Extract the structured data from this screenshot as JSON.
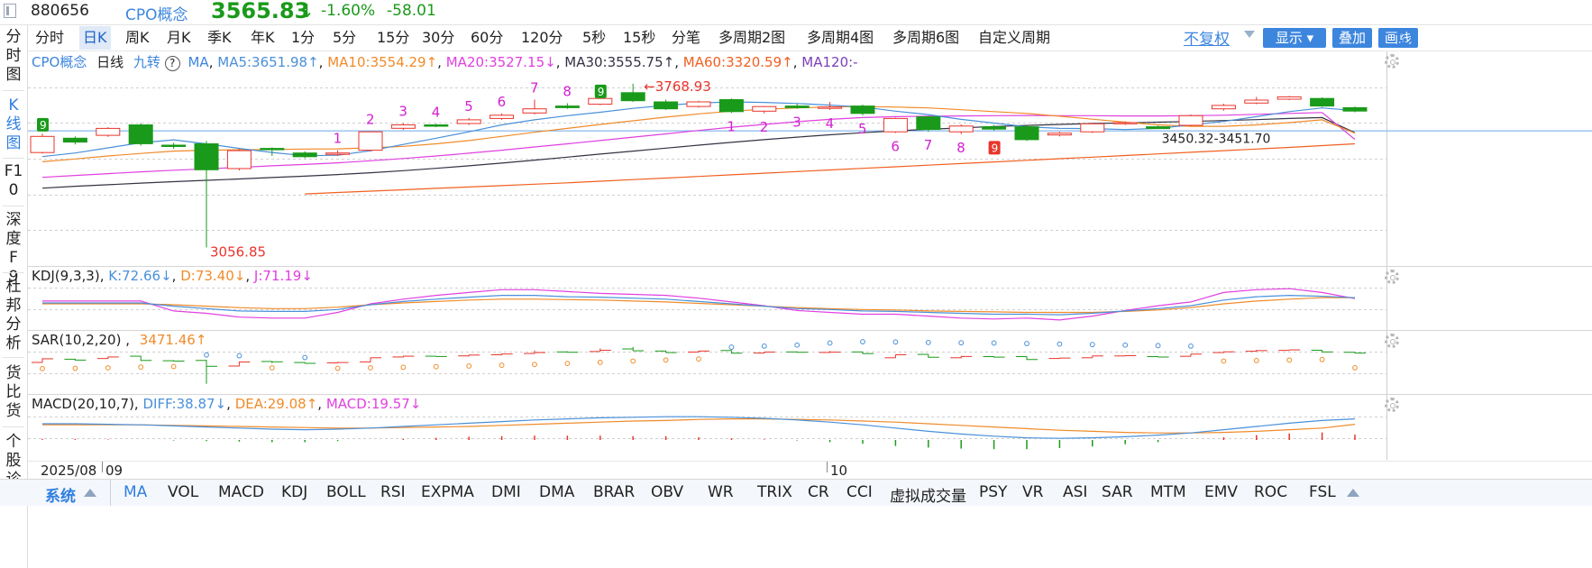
{
  "header": {
    "code": "880656",
    "name": "CPO概念",
    "price": "3565.83",
    "change_pct": "-1.60%",
    "change_val": "-58.01"
  },
  "left_tabs": [
    "分时图",
    "K线图",
    "F10",
    "深度F9",
    "杜邦分析",
    "货比货",
    "个股诊断"
  ],
  "periods": [
    "分时",
    "日K",
    "周K",
    "月K",
    "季K",
    "年K",
    "1分",
    "5分",
    "15分",
    "30分",
    "60分",
    "120分",
    "5秒",
    "15秒",
    "分笔",
    "多周期2图",
    "多周期4图",
    "多周期6图",
    "自定义周期"
  ],
  "period_active": "日K",
  "right_tools": {
    "fq": "不复权",
    "display": "显示",
    "overlay": "叠加",
    "draw": "画线"
  },
  "main_legend": {
    "name": "CPO概念",
    "period": "日线",
    "nine": "九转",
    "help": "?",
    "ma": "MA",
    "ma5": "MA5:3651.98↑",
    "ma10": "MA10:3554.29↑",
    "ma20": "MA20:3527.15↓",
    "ma30": "MA30:3555.75↑",
    "ma60": "MA60:3320.59↑",
    "ma120": "MA120:-"
  },
  "main_annotations": {
    "high": "3768.93",
    "low": "3056.85",
    "range": "3450.32-3451.70",
    "top_counts": [
      "1",
      "2",
      "3",
      "4",
      "5",
      "6",
      "7",
      "8"
    ],
    "bottom_counts": [
      "1",
      "2",
      "3",
      "4",
      "5",
      "6",
      "7",
      "8"
    ],
    "nine_badge": "9"
  },
  "kdj_legend": {
    "name": "KDJ(9,3,3)",
    "k": "K:72.66↓",
    "d": "D:73.40↓",
    "j": "J:71.19↓"
  },
  "sar_legend": {
    "name": "SAR(10,2,20)",
    "sep": ",",
    "val": "3471.46↑"
  },
  "macd_legend": {
    "name": "MACD(20,10,7)",
    "diff": "DIFF:38.87↓",
    "dea": "DEA:29.08↑",
    "macd": "MACD:19.57↓"
  },
  "dates": {
    "start": "2025/08",
    "d1": "09",
    "d2": "10"
  },
  "indicator_tabs": [
    "系统",
    "MA",
    "VOL",
    "MACD",
    "KDJ",
    "BOLL",
    "RSI",
    "EXPMA",
    "DMI",
    "DMA",
    "BRAR",
    "OBV",
    "WR",
    "TRIX",
    "CR",
    "CCI",
    "虚拟成交量",
    "PSY",
    "VR",
    "ASI",
    "SAR",
    "MTM",
    "EMV",
    "ROC",
    "FSL"
  ],
  "indicator_active": "MA",
  "colors": {
    "up": "#e8352c",
    "down": "#1a9a1a",
    "accent": "#3d86de",
    "ma5": "#4a90d9",
    "ma10": "#f08b2a",
    "ma20": "#e040e0",
    "ma30": "#333344",
    "ma60": "#f06020"
  },
  "candles": [
    {
      "o": 3470,
      "c": 3540,
      "h": 3552,
      "l": 3465
    },
    {
      "o": 3532,
      "c": 3515,
      "h": 3540,
      "l": 3505
    },
    {
      "o": 3545,
      "c": 3575,
      "h": 3580,
      "l": 3538
    },
    {
      "o": 3590,
      "c": 3508,
      "h": 3598,
      "l": 3500
    },
    {
      "o": 3502,
      "c": 3496,
      "h": 3512,
      "l": 3486
    },
    {
      "o": 3508,
      "c": 3395,
      "h": 3520,
      "l": 3057
    },
    {
      "o": 3400,
      "c": 3478,
      "h": 3485,
      "l": 3392
    },
    {
      "o": 3488,
      "c": 3482,
      "h": 3492,
      "l": 3455
    },
    {
      "o": 3468,
      "c": 3452,
      "h": 3475,
      "l": 3445
    },
    {
      "o": 3462,
      "c": 3468,
      "h": 3480,
      "l": 3455
    },
    {
      "o": 3480,
      "c": 3560,
      "h": 3562,
      "l": 3475
    },
    {
      "o": 3575,
      "c": 3590,
      "h": 3598,
      "l": 3568
    },
    {
      "o": 3590,
      "c": 3584,
      "h": 3595,
      "l": 3580
    },
    {
      "o": 3596,
      "c": 3612,
      "h": 3620,
      "l": 3590
    },
    {
      "o": 3618,
      "c": 3632,
      "h": 3640,
      "l": 3612
    },
    {
      "o": 3642,
      "c": 3660,
      "h": 3700,
      "l": 3636
    },
    {
      "o": 3672,
      "c": 3665,
      "h": 3684,
      "l": 3660
    },
    {
      "o": 3680,
      "c": 3705,
      "h": 3740,
      "l": 3676
    },
    {
      "o": 3730,
      "c": 3695,
      "h": 3769,
      "l": 3690
    },
    {
      "o": 3690,
      "c": 3660,
      "h": 3700,
      "l": 3655
    },
    {
      "o": 3670,
      "c": 3690,
      "h": 3695,
      "l": 3665
    },
    {
      "o": 3700,
      "c": 3648,
      "h": 3705,
      "l": 3642
    },
    {
      "o": 3650,
      "c": 3670,
      "h": 3672,
      "l": 3640
    },
    {
      "o": 3672,
      "c": 3665,
      "h": 3682,
      "l": 3660
    },
    {
      "o": 3662,
      "c": 3668,
      "h": 3690,
      "l": 3655
    },
    {
      "o": 3672,
      "c": 3640,
      "h": 3678,
      "l": 3632
    },
    {
      "o": 3560,
      "c": 3618,
      "h": 3622,
      "l": 3555
    },
    {
      "o": 3625,
      "c": 3570,
      "h": 3630,
      "l": 3560
    },
    {
      "o": 3560,
      "c": 3585,
      "h": 3592,
      "l": 3550
    },
    {
      "o": 3582,
      "c": 3572,
      "h": 3590,
      "l": 3565
    },
    {
      "o": 3582,
      "c": 3526,
      "h": 3588,
      "l": 3520
    },
    {
      "o": 3546,
      "c": 3554,
      "h": 3560,
      "l": 3540
    },
    {
      "o": 3560,
      "c": 3595,
      "h": 3600,
      "l": 3555
    },
    {
      "o": 3595,
      "c": 3600,
      "h": 3605,
      "l": 3590
    },
    {
      "o": 3582,
      "c": 3574,
      "h": 3587,
      "l": 3572
    },
    {
      "o": 3588,
      "c": 3630,
      "h": 3636,
      "l": 3584
    },
    {
      "o": 3660,
      "c": 3675,
      "h": 3682,
      "l": 3652
    },
    {
      "o": 3685,
      "c": 3698,
      "h": 3712,
      "l": 3680
    },
    {
      "o": 3702,
      "c": 3712,
      "h": 3716,
      "l": 3698
    },
    {
      "o": 3705,
      "c": 3672,
      "h": 3710,
      "l": 3668
    },
    {
      "o": 3665,
      "c": 3650,
      "h": 3670,
      "l": 3645
    }
  ],
  "ma": {
    "ma5": [
      3452,
      3468,
      3490,
      3512,
      3525,
      3508,
      3488,
      3470,
      3456,
      3458,
      3478,
      3505,
      3532,
      3560,
      3590,
      3612,
      3630,
      3645,
      3662,
      3675,
      3685,
      3690,
      3688,
      3683,
      3676,
      3668,
      3650,
      3635,
      3614,
      3598,
      3582,
      3575,
      3574,
      3570,
      3575,
      3590,
      3605,
      3626,
      3648,
      3664,
      3652
    ],
    "ma10": [
      3430,
      3442,
      3455,
      3466,
      3476,
      3480,
      3482,
      3483,
      3485,
      3486,
      3490,
      3497,
      3508,
      3522,
      3540,
      3558,
      3575,
      3592,
      3608,
      3624,
      3638,
      3650,
      3658,
      3664,
      3668,
      3670,
      3668,
      3664,
      3656,
      3648,
      3640,
      3628,
      3615,
      3602,
      3590,
      3584,
      3584,
      3590,
      3600,
      3612,
      3554
    ],
    "ma20": [
      3362,
      3370,
      3378,
      3386,
      3393,
      3399,
      3405,
      3412,
      3418,
      3425,
      3434,
      3444,
      3455,
      3467,
      3480,
      3494,
      3508,
      3522,
      3537,
      3551,
      3566,
      3580,
      3592,
      3604,
      3614,
      3622,
      3626,
      3628,
      3629,
      3630,
      3631,
      3630,
      3630,
      3629,
      3629,
      3630,
      3632,
      3636,
      3640,
      3644,
      3527
    ],
    "ma30": [
      3315,
      3323,
      3330,
      3337,
      3343,
      3349,
      3355,
      3361,
      3367,
      3374,
      3382,
      3391,
      3401,
      3412,
      3424,
      3437,
      3450,
      3463,
      3476,
      3489,
      3502,
      3514,
      3526,
      3537,
      3547,
      3556,
      3564,
      3571,
      3577,
      3583,
      3588,
      3592,
      3596,
      3599,
      3602,
      3605,
      3609,
      3613,
      3618,
      3622,
      3556
    ],
    "ma60": [
      null,
      null,
      null,
      null,
      null,
      null,
      null,
      null,
      3290,
      3296,
      3302,
      3308,
      3314,
      3320,
      3326,
      3332,
      3338,
      3345,
      3352,
      3359,
      3366,
      3373,
      3380,
      3387,
      3394,
      3401,
      3408,
      3415,
      3422,
      3429,
      3436,
      3443,
      3450,
      3457,
      3464,
      3471,
      3478,
      3485,
      3492,
      3500,
      3508
    ]
  },
  "kdj": {
    "k": [
      62,
      62,
      62,
      62,
      55,
      50,
      45,
      44,
      44,
      48,
      58,
      65,
      70,
      74,
      78,
      78,
      75,
      74,
      72,
      70,
      65,
      60,
      55,
      50,
      48,
      45,
      44,
      42,
      40,
      38,
      38,
      37,
      40,
      45,
      50,
      56,
      68,
      75,
      78,
      76,
      73
    ],
    "d": [
      60,
      60,
      60,
      60,
      58,
      55,
      52,
      50,
      50,
      53,
      58,
      62,
      65,
      68,
      70,
      70,
      69,
      68,
      66,
      64,
      61,
      58,
      55,
      52,
      50,
      48,
      47,
      45,
      44,
      43,
      42,
      42,
      42,
      44,
      47,
      52,
      60,
      66,
      70,
      73,
      73
    ],
    "j": [
      66,
      66,
      66,
      66,
      45,
      40,
      32,
      30,
      30,
      42,
      60,
      70,
      78,
      84,
      90,
      90,
      86,
      82,
      80,
      78,
      72,
      64,
      56,
      46,
      42,
      38,
      38,
      34,
      30,
      28,
      30,
      26,
      34,
      46,
      56,
      64,
      84,
      90,
      92,
      84,
      71
    ]
  },
  "sar": [
    3455,
    3460,
    3470,
    3485,
    3495,
    3510,
    3495,
    3470,
    3460,
    3460,
    3470,
    3480,
    3492,
    3505,
    3520,
    3535,
    3555,
    3575,
    3600,
    3620,
    3640,
    3660,
    3680,
    3700,
    3740,
    3765,
    3760,
    3750,
    3745,
    3740,
    3730,
    3720,
    3710,
    3700,
    3690,
    3680,
    3600,
    3610,
    3620,
    3630,
    3471
  ],
  "macd": {
    "diff": [
      30,
      30,
      29,
      28,
      26,
      24,
      22,
      20,
      19,
      20,
      22,
      25,
      28,
      31,
      34,
      37,
      39,
      41,
      42,
      43,
      43,
      42,
      40,
      37,
      33,
      28,
      22,
      16,
      11,
      7,
      4,
      3,
      4,
      6,
      9,
      13,
      19,
      25,
      31,
      36,
      39
    ],
    "dea": [
      28,
      28,
      28,
      28,
      27,
      26,
      25,
      24,
      23,
      22,
      22,
      23,
      24,
      25,
      27,
      29,
      31,
      33,
      35,
      36,
      38,
      39,
      39,
      38,
      37,
      35,
      33,
      30,
      27,
      24,
      21,
      18,
      16,
      14,
      13,
      13,
      14,
      16,
      19,
      22,
      29
    ],
    "macd": [
      4,
      4,
      2,
      0,
      -2,
      -4,
      -6,
      -8,
      -8,
      -4,
      0,
      4,
      8,
      12,
      14,
      16,
      16,
      16,
      14,
      14,
      10,
      6,
      2,
      -2,
      -8,
      -14,
      -22,
      -28,
      -32,
      -34,
      -34,
      -30,
      -24,
      -16,
      -8,
      0,
      10,
      18,
      24,
      28,
      20
    ]
  }
}
